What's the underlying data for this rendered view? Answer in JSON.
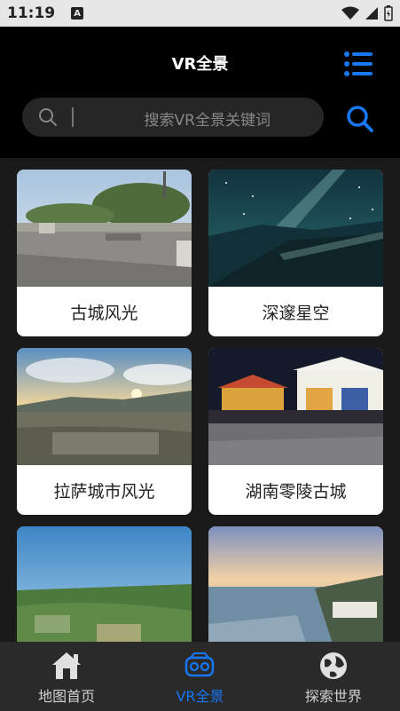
{
  "status_bar": {
    "time": "11:19",
    "notification_icon": "A"
  },
  "header": {
    "title": "VR全景",
    "menu_icon": "list-icon"
  },
  "search": {
    "placeholder": "搜索VR全景关键词",
    "button_icon": "search-icon"
  },
  "cards": [
    {
      "label": "古城风光"
    },
    {
      "label": "深邃星空"
    },
    {
      "label": "拉萨城市风光"
    },
    {
      "label": "湖南零陵古城"
    },
    {
      "label": ""
    },
    {
      "label": ""
    }
  ],
  "tabbar": {
    "tabs": [
      {
        "label": "地图首页",
        "icon": "home-icon",
        "active": false
      },
      {
        "label": "VR全景",
        "icon": "vr-goggles-icon",
        "active": true
      },
      {
        "label": "探索世界",
        "icon": "globe-icon",
        "active": false
      }
    ]
  },
  "colors": {
    "accent": "#1877f2",
    "header_bg": "#000000",
    "page_bg": "#1a1a1a"
  }
}
